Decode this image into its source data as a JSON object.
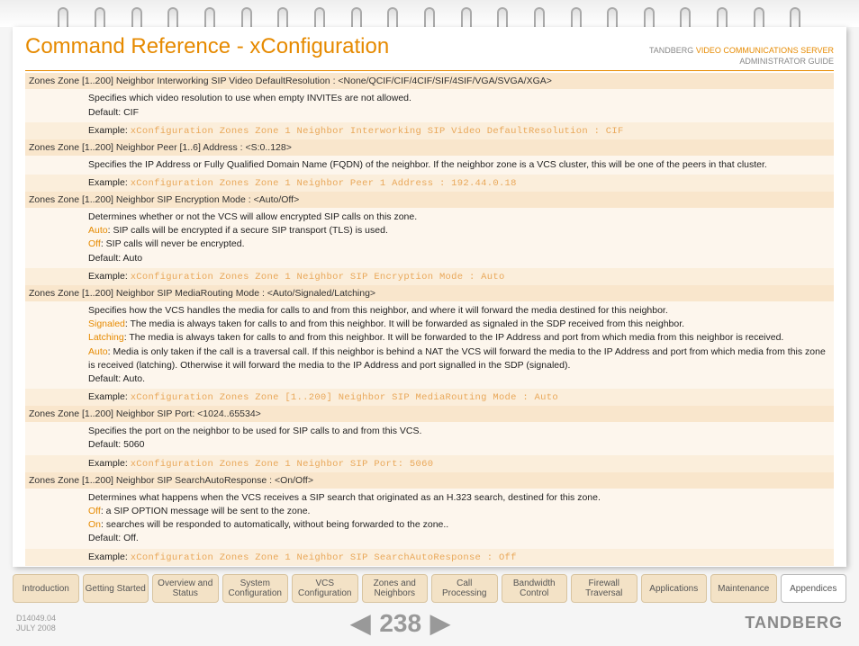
{
  "header": {
    "title": "Command Reference - xConfiguration",
    "brand": "TANDBERG",
    "product": "VIDEO COMMUNICATIONS SERVER",
    "subtitle": "ADMINISTRATOR GUIDE"
  },
  "sections": [
    {
      "head": "Zones Zone [1..200] Neighbor Interworking SIP Video DefaultResolution : <None/QCIF/CIF/4CIF/SIF/4SIF/VGA/SVGA/XGA>",
      "body": [
        {
          "text": "Specifies which video resolution to use when empty INVITEs are not allowed."
        },
        {
          "text": "Default: CIF"
        }
      ],
      "exampleLabel": "Example:",
      "example": "xConfiguration Zones Zone 1 Neighbor Interworking SIP Video DefaultResolution : CIF"
    },
    {
      "head": "Zones Zone [1..200] Neighbor Peer [1..6] Address : <S:0..128>",
      "body": [
        {
          "text": "Specifies the IP Address or Fully Qualified Domain Name (FQDN) of the neighbor. If the neighbor zone is a VCS cluster, this will be one of the peers in that cluster."
        }
      ],
      "exampleLabel": "Example:",
      "example": "xConfiguration Zones Zone 1 Neighbor Peer 1 Address : 192.44.0.18"
    },
    {
      "head": "Zones Zone [1..200] Neighbor SIP Encryption Mode : <Auto/Off>",
      "body": [
        {
          "text": "Determines whether or not the VCS will allow encrypted SIP calls on this zone."
        },
        {
          "kw": "Auto",
          "rest": ": SIP calls will be encrypted if a secure SIP transport (TLS) is used."
        },
        {
          "kw": "Off",
          "rest": ": SIP calls will never be encrypted."
        },
        {
          "text": "Default: Auto"
        }
      ],
      "exampleLabel": "Example:",
      "example": "xConfiguration Zones Zone 1 Neighbor SIP Encryption Mode : Auto"
    },
    {
      "head": "Zones Zone [1..200] Neighbor SIP MediaRouting Mode : <Auto/Signaled/Latching>",
      "body": [
        {
          "text": "Specifies how the VCS handles the media for calls to and from this neighbor, and where it will forward the media destined for this neighbor."
        },
        {
          "kw": "Signaled",
          "rest": ": The media is always taken for calls to and from this neighbor. It will be forwarded as signaled in the SDP received from this neighbor."
        },
        {
          "kw": "Latching",
          "rest": ": The media is always taken for calls to and from this neighbor. It will be forwarded to the IP Address and port from which media from this neighbor is received."
        },
        {
          "kw": "Auto",
          "rest": ": Media is only taken if the call is a traversal call. If this neighbor is behind a NAT the VCS will forward the media to the IP Address and port from which media from this zone is received (latching).  Otherwise it will forward the media to the IP Address and port signalled in the SDP (signaled)."
        },
        {
          "text": "Default: Auto."
        }
      ],
      "exampleLabel": "Example:",
      "example": "xConfiguration Zones Zone [1..200] Neighbor SIP MediaRouting Mode : Auto"
    },
    {
      "head": "Zones Zone [1..200] Neighbor SIP Port: <1024..65534>",
      "body": [
        {
          "text": "Specifies the port on the neighbor to be used for SIP calls to and from this VCS."
        },
        {
          "text": "Default: 5060"
        }
      ],
      "exampleLabel": "Example:",
      "example": "xConfiguration Zones Zone 1 Neighbor SIP Port: 5060"
    },
    {
      "head": "Zones Zone [1..200] Neighbor SIP SearchAutoResponse : <On/Off>",
      "body": [
        {
          "text": "Determines what happens when the VCS receives a SIP search that originated as an H.323 search, destined for this zone."
        },
        {
          "kw": "Off",
          "rest": ": a SIP OPTION message will be sent to the zone."
        },
        {
          "kw": "On",
          "rest": ": searches will be responded to automatically, without being forwarded to the zone.."
        },
        {
          "text": "Default: Off."
        }
      ],
      "exampleLabel": "Example:",
      "example": "xConfiguration Zones Zone 1 Neighbor SIP SearchAutoResponse : Off"
    }
  ],
  "tabs": [
    "Introduction",
    "Getting Started",
    "Overview and Status",
    "System Configuration",
    "VCS Configuration",
    "Zones and Neighbors",
    "Call Processing",
    "Bandwidth Control",
    "Firewall Traversal",
    "Applications",
    "Maintenance",
    "Appendices"
  ],
  "activeTab": "Appendices",
  "footer": {
    "docid": "D14049.04",
    "date": "JULY 2008",
    "page": "238",
    "logo": "TANDBERG"
  }
}
